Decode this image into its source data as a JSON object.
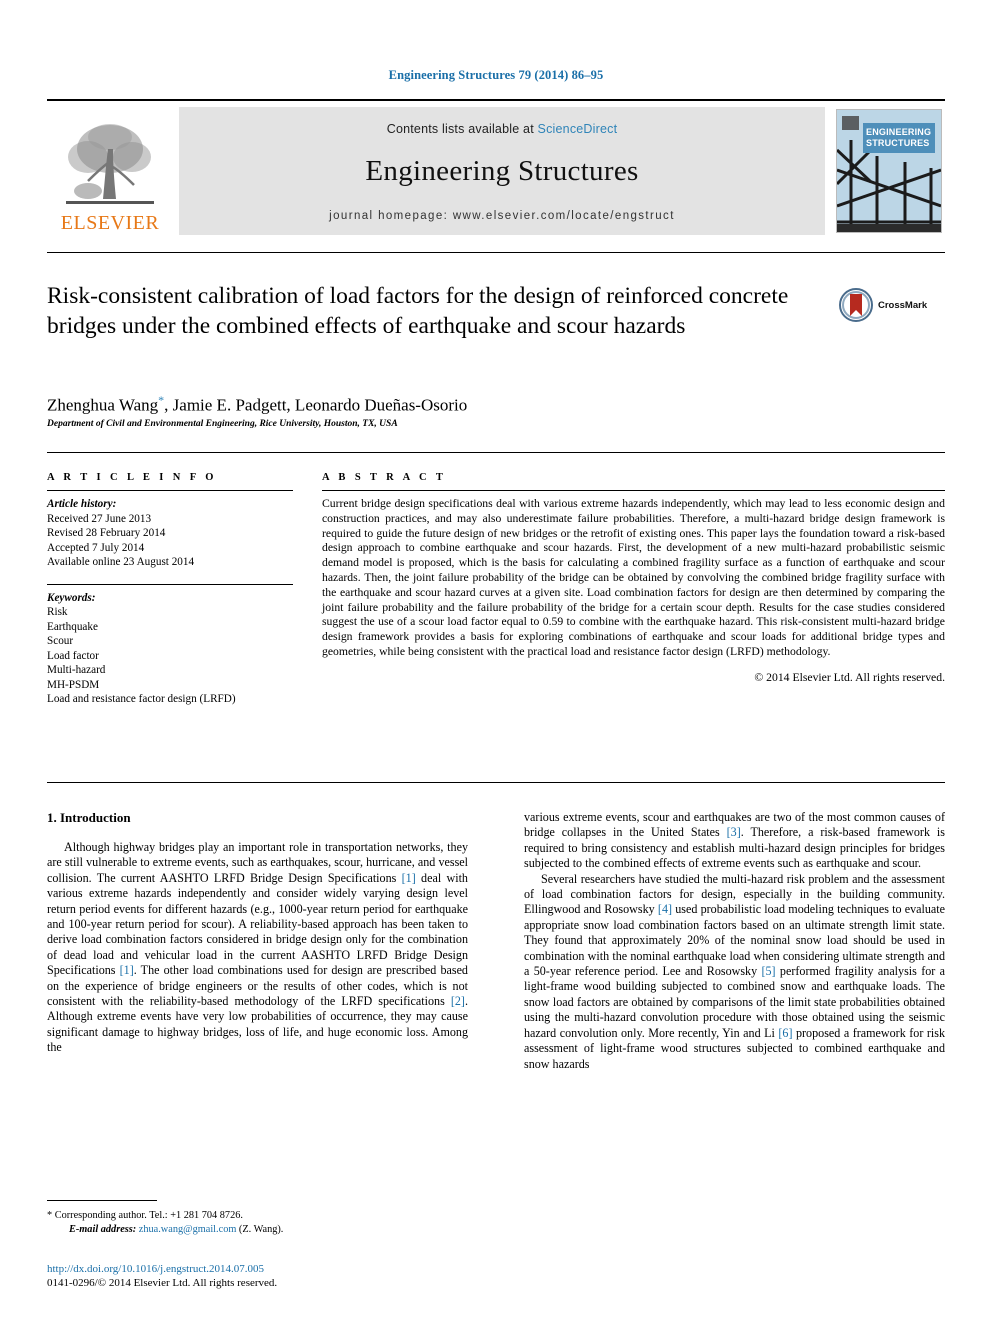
{
  "running_head": "Engineering Structures 79 (2014) 86–95",
  "masthead": {
    "contents_prefix": "Contents lists available at ",
    "sciencedirect": "ScienceDirect",
    "journal_name": "Engineering Structures",
    "homepage": "journal homepage: www.elsevier.com/locate/engstruct",
    "publisher_logo_word": "ELSEVIER",
    "cover_title_line1": "ENGINEERING",
    "cover_title_line2": "STRUCTURES"
  },
  "article": {
    "title": "Risk-consistent calibration of load factors for the design of reinforced concrete bridges under the combined effects of earthquake and scour hazards",
    "crossmark_label": "CrossMark",
    "authors": "Zhenghua Wang*, Jamie E. Padgett, Leonardo Dueñas-Osorio",
    "authors_name_1": "Zhenghua Wang",
    "authors_rest": ", Jamie E. Padgett, Leonardo Dueñas-Osorio",
    "corresponding_marker": "*",
    "affiliation": "Department of Civil and Environmental Engineering, Rice University, Houston, TX, USA"
  },
  "article_info": {
    "heading": "A R T I C L E   I N F O",
    "history_label": "Article history:",
    "history": [
      "Received 27 June 2013",
      "Revised 28 February 2014",
      "Accepted 7 July 2014",
      "Available online 23 August 2014"
    ],
    "keywords_label": "Keywords:",
    "keywords": [
      "Risk",
      "Earthquake",
      "Scour",
      "Load factor",
      "Multi-hazard",
      "MH-PSDM",
      "Load and resistance factor design (LRFD)"
    ]
  },
  "abstract": {
    "heading": "A B S T R A C T",
    "text": "Current bridge design specifications deal with various extreme hazards independently, which may lead to less economic design and construction practices, and may also underestimate failure probabilities. Therefore, a multi-hazard bridge design framework is required to guide the future design of new bridges or the retrofit of existing ones. This paper lays the foundation toward a risk-based design approach to combine earthquake and scour hazards. First, the development of a new multi-hazard probabilistic seismic demand model is proposed, which is the basis for calculating a combined fragility surface as a function of earthquake and scour hazards. Then, the joint failure probability of the bridge can be obtained by convolving the combined bridge fragility surface with the earthquake and scour hazard curves at a given site. Load combination factors for design are then determined by comparing the joint failure probability and the failure probability of the bridge for a certain scour depth. Results for the case studies considered suggest the use of a scour load factor equal to 0.59 to combine with the earthquake hazard. This risk-consistent multi-hazard bridge design framework provides a basis for exploring combinations of earthquake and scour loads for additional bridge types and geometries, while being consistent with the practical load and resistance factor design (LRFD) methodology.",
    "copyright": "© 2014 Elsevier Ltd. All rights reserved."
  },
  "body": {
    "section_heading": "1. Introduction",
    "left_paragraph_1_a": "Although highway bridges play an important role in transportation networks, they are still vulnerable to extreme events, such as earthquakes, scour, hurricane, and vessel collision. The current AASHTO LRFD Bridge Design Specifications ",
    "left_ref_1": "[1]",
    "left_paragraph_1_b": " deal with various extreme hazards independently and consider widely varying design level return period events for different hazards (e.g., 1000-year return period for earthquake and 100-year return period for scour). A reliability-based approach has been taken to derive load combination factors considered in bridge design only for the combination of dead load and vehicular load in the current AASHTO LRFD Bridge Design Specifications ",
    "left_ref_2": "[1]",
    "left_paragraph_1_c": ". The other load combinations used for design are prescribed based on the experience of bridge engineers or the results of other codes, which is not consistent with the reliability-based methodology of the LRFD specifications ",
    "left_ref_3": "[2]",
    "left_paragraph_1_d": ". Although extreme events have very low probabilities of occurrence, they may cause significant damage to highway bridges, loss of life, and huge economic loss. Among the",
    "right_paragraph_1_a": "various extreme events, scour and earthquakes are two of the most common causes of bridge collapses in the United States ",
    "right_ref_3": "[3]",
    "right_paragraph_1_b": ". Therefore, a risk-based framework is required to bring consistency and establish multi-hazard design principles for bridges subjected to the combined effects of extreme events such as earthquake and scour.",
    "right_paragraph_2_a": "Several researchers have studied the multi-hazard risk problem and the assessment of load combination factors for design, especially in the building community. Ellingwood and Rosowsky ",
    "right_ref_4": "[4]",
    "right_paragraph_2_b": " used probabilistic load modeling techniques to evaluate appropriate snow load combination factors based on an ultimate strength limit state. They found that approximately 20% of the nominal snow load should be used in combination with the nominal earthquake load when considering ultimate strength and a 50-year reference period. Lee and Rosowsky ",
    "right_ref_5": "[5]",
    "right_paragraph_2_c": " performed fragility analysis for a light-frame wood building subjected to combined snow and earthquake loads. The snow load factors are obtained by comparisons of the limit state probabilities obtained using the multi-hazard convolution procedure with those obtained using the seismic hazard convolution only. More recently, Yin and Li ",
    "right_ref_6": "[6]",
    "right_paragraph_2_d": " proposed a framework for risk assessment of light-frame wood structures subjected to combined earthquake and snow hazards"
  },
  "footnote": {
    "corresponding": "* Corresponding author. Tel.: +1 281 704 8726.",
    "email_label": "E-mail address:",
    "email": "zhua.wang@gmail.com",
    "email_suffix": " (Z. Wang)."
  },
  "doi": {
    "url": "http://dx.doi.org/10.1016/j.engstruct.2014.07.005",
    "issn_line": "0141-0296/© 2014 Elsevier Ltd. All rights reserved."
  },
  "colors": {
    "link": "#1a6fa8",
    "sciencedirect": "#2f84b8",
    "elsevier_orange": "#e77817",
    "band_gray": "#e3e3e3",
    "cover_blue": "#4e8fba"
  }
}
